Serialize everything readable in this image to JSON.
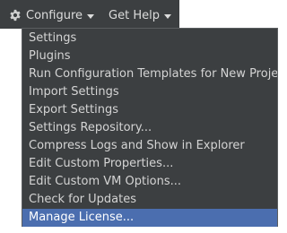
{
  "toolbar": {
    "configure_label": "Configure",
    "get_help_label": "Get Help",
    "configure_icon": "gear-icon",
    "dropdown_icon": "caret-down-icon"
  },
  "menu": {
    "items": [
      {
        "label": "Settings"
      },
      {
        "label": "Plugins"
      },
      {
        "label": "Run Configuration Templates for New Projects"
      },
      {
        "label": "Import Settings"
      },
      {
        "label": "Export Settings"
      },
      {
        "label": "Settings Repository..."
      },
      {
        "label": "Compress Logs and Show in Explorer"
      },
      {
        "label": "Edit Custom Properties..."
      },
      {
        "label": "Edit Custom VM Options..."
      },
      {
        "label": "Check for Updates"
      },
      {
        "label": "Manage License..."
      }
    ],
    "selected_index": 10
  },
  "colors": {
    "background": "#3c3f41",
    "text": "#d4d4d4",
    "selection": "#4b6eaf"
  }
}
